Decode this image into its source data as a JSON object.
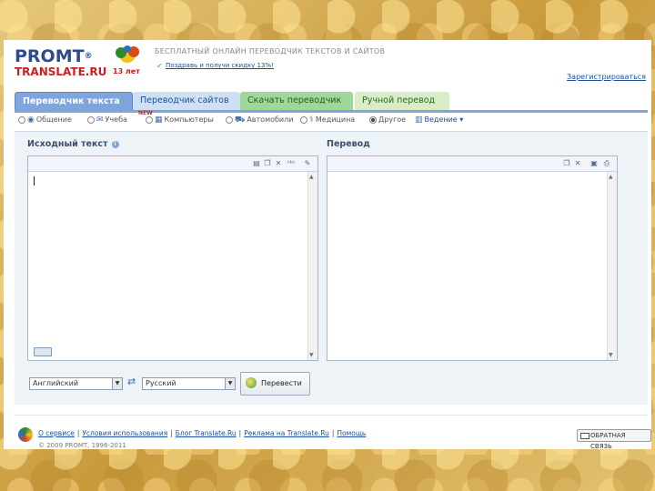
{
  "header": {
    "logo_brand": "PROMT",
    "logo_reg": "®",
    "logo_site": "TRANSLATE.RU",
    "years_badge": "13 лет",
    "slogan": "БЕСПЛАТНЫЙ ОНЛАЙН ПЕРЕВОДЧИК ТЕКСТОВ И САЙТОВ",
    "promo": "Поздравь и получи скидку 13%!",
    "register": "Зарегистрироваться"
  },
  "tabs": [
    {
      "label": "Переводчик текста"
    },
    {
      "label": "Переводчик сайтов"
    },
    {
      "label": "Скачать переводчик"
    },
    {
      "label": "Ручной перевод"
    }
  ],
  "topics": {
    "new_badge": "NEW",
    "items": [
      {
        "label": "Общение",
        "icon": "chat-icon"
      },
      {
        "label": "Учеба",
        "icon": "mail-icon"
      },
      {
        "label": "Компьютеры",
        "icon": "computer-icon"
      },
      {
        "label": "Автомобили",
        "icon": "car-icon"
      },
      {
        "label": "Медицина",
        "icon": "medicine-icon"
      },
      {
        "label": "Другое",
        "icon": "other-icon"
      },
      {
        "label": "Ведение ▾",
        "icon": "more-icon"
      }
    ],
    "selected": "Другое"
  },
  "source": {
    "label": "Исходный текст",
    "value": ""
  },
  "target": {
    "label": "Перевод",
    "value": ""
  },
  "languages": {
    "from": "Английский",
    "to": "Русский"
  },
  "translate_button": "Перевести",
  "footer": {
    "links": [
      "О сервисе",
      "Условия использования",
      "Блог Translate.Ru",
      "Реклама на Translate.Ru",
      "Помощь"
    ],
    "copyright": "© 2009 PROMT, 1996-2011",
    "feedback": "ОБРАТНАЯ СВЯЗЬ"
  },
  "colors": {
    "active_tab": "#7fa6dc",
    "brand_blue": "#2c4a8c",
    "brand_red": "#c8201e",
    "link": "#1a4fa0"
  }
}
